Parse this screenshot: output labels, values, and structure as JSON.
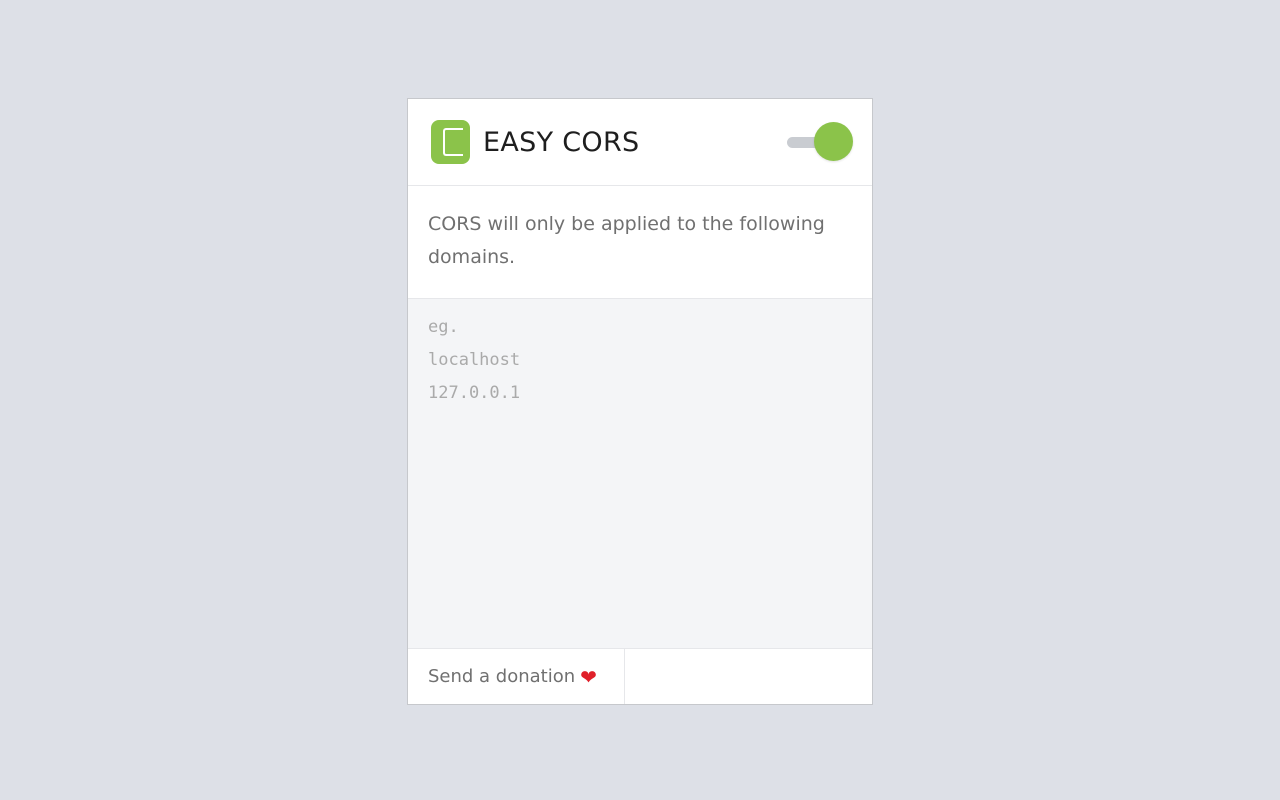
{
  "header": {
    "title": "EASY CORS",
    "logo_icon": "c-letter-logo-icon",
    "toggle_state": "on"
  },
  "description": "CORS will only be applied to the following domains.",
  "domains": {
    "value": "",
    "placeholder": "eg.\nlocalhost\n127.0.0.1"
  },
  "footer": {
    "donate_label": "Send a donation",
    "heart_icon": "heart-icon",
    "heart_glyph": "❤"
  },
  "colors": {
    "accent": "#8bc34a",
    "background": "#dde0e7",
    "text": "#707070"
  }
}
